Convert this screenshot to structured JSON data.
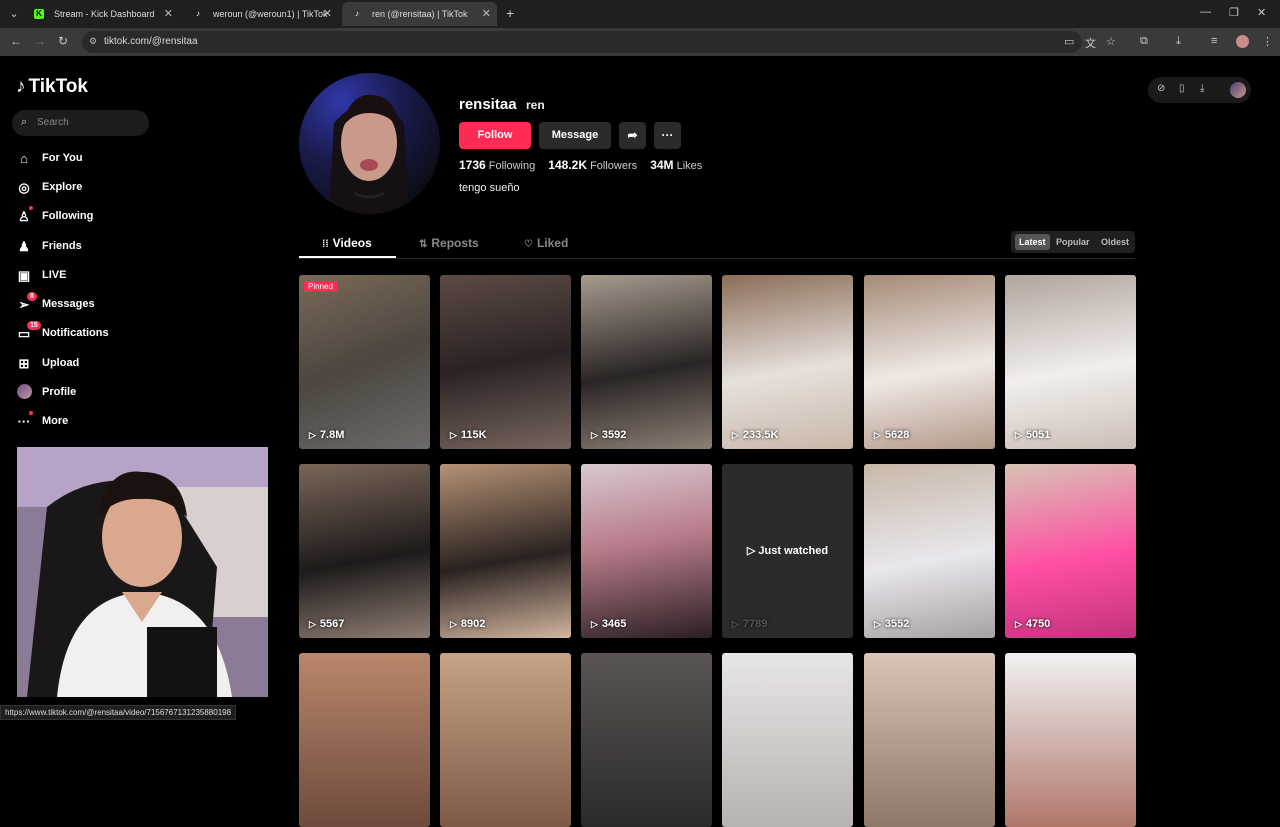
{
  "browser": {
    "tabs": [
      {
        "title": "Stream - Kick Dashboard",
        "favicon": "kick-icon"
      },
      {
        "title": "weroun (@weroun1) | TikTok",
        "favicon": "tiktok-icon"
      },
      {
        "title": "ren (@rensitaa) | TikTok",
        "favicon": "tiktok-icon",
        "active": true
      }
    ],
    "url": "tiktok.com/@rensitaa",
    "status_url": "https://www.tiktok.com/@rensitaa/video/7156767131235880198"
  },
  "sidebar": {
    "logo": "TikTok",
    "search_placeholder": "Search",
    "items": [
      {
        "label": "For You",
        "icon": "home-icon"
      },
      {
        "label": "Explore",
        "icon": "compass-icon"
      },
      {
        "label": "Following",
        "icon": "person-icon",
        "dot": true
      },
      {
        "label": "Friends",
        "icon": "friends-icon"
      },
      {
        "label": "LIVE",
        "icon": "live-icon"
      },
      {
        "label": "Messages",
        "icon": "paper-plane-icon",
        "badge": "8"
      },
      {
        "label": "Notifications",
        "icon": "inbox-icon",
        "badge": "15"
      },
      {
        "label": "Upload",
        "icon": "plus-square-icon"
      },
      {
        "label": "Profile",
        "icon": "avatar-icon"
      },
      {
        "label": "More",
        "icon": "ellipsis-icon",
        "dot": true
      }
    ]
  },
  "profile": {
    "username": "rensitaa",
    "nickname": "ren",
    "follow_label": "Follow",
    "message_label": "Message",
    "following_count": "1736",
    "following_label": "Following",
    "followers_count": "148.2K",
    "followers_label": "Followers",
    "likes_count": "34M",
    "likes_label": "Likes",
    "bio": "tengo sueño"
  },
  "tabs": [
    {
      "label": "Videos",
      "icon": "grid-icon",
      "active": true
    },
    {
      "label": "Reposts",
      "icon": "repost-icon"
    },
    {
      "label": "Liked",
      "icon": "heart-icon"
    }
  ],
  "sort": [
    {
      "label": "Latest",
      "active": true
    },
    {
      "label": "Popular"
    },
    {
      "label": "Oldest"
    }
  ],
  "videos": [
    {
      "views": "7.8M",
      "pinned": "Pinned"
    },
    {
      "views": "115K"
    },
    {
      "views": "3592"
    },
    {
      "views": "233.5K"
    },
    {
      "views": "5628"
    },
    {
      "views": "5051"
    },
    {
      "views": "5567"
    },
    {
      "views": "8902"
    },
    {
      "views": "3465"
    },
    {
      "views": "7789",
      "watched": "Just watched"
    },
    {
      "views": "3552"
    },
    {
      "views": "4750"
    },
    {
      "views": ""
    },
    {
      "views": ""
    },
    {
      "views": ""
    },
    {
      "views": ""
    },
    {
      "views": ""
    },
    {
      "views": ""
    }
  ],
  "colors": {
    "accent": "#fe2c55",
    "background": "#000000"
  }
}
